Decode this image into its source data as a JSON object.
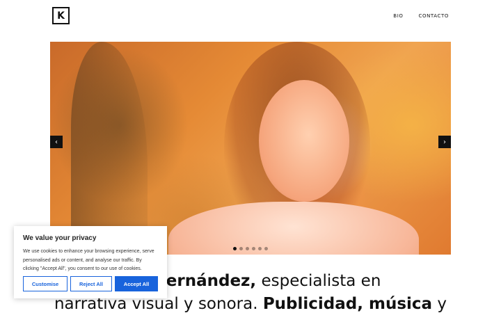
{
  "header": {
    "logo_letter": "K",
    "nav": [
      "BIO",
      "CONTACTO"
    ]
  },
  "slider": {
    "prev_glyph": "‹",
    "next_glyph": "›",
    "slide_count": 6,
    "active_index": 0
  },
  "headline": {
    "line1_bold": "der Fernández,",
    "line1_rest": " especialista en",
    "line2_start": "narrativa visual y sonora. ",
    "line2_bold": "Publicidad, música",
    "line2_end": " y"
  },
  "cookie_banner": {
    "title": "We value your privacy",
    "body": "We use cookies to enhance your browsing experience, serve personalised ads or content, and analyse our traffic. By clicking \"Accept All\", you consent to our use of cookies.",
    "customise_label": "Customise",
    "reject_label": "Reject All",
    "accept_label": "Accept All"
  },
  "colors": {
    "accent": "#1863dc",
    "text": "#111111"
  }
}
